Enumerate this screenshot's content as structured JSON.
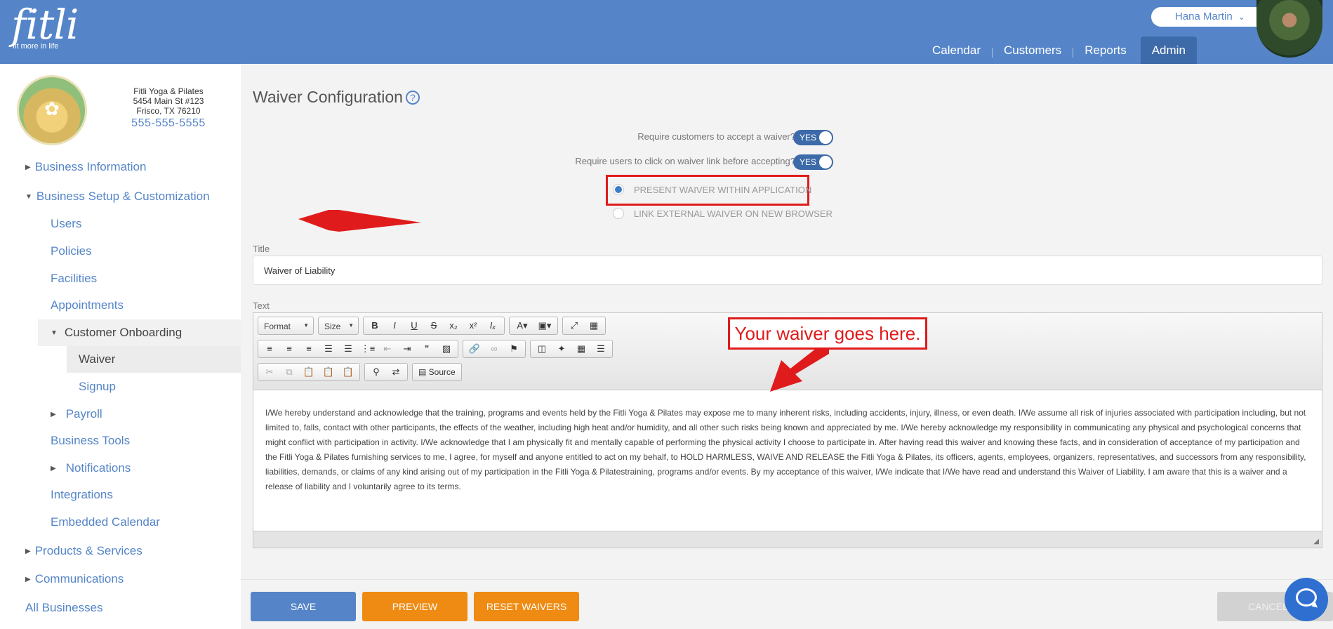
{
  "header": {
    "logo_text": "fitli",
    "logo_tagline": "fit more in life",
    "user_name": "Hana Martin",
    "nav": [
      "Calendar",
      "Customers",
      "Reports",
      "Admin"
    ],
    "active_nav": "Admin"
  },
  "business": {
    "name": "Fitli Yoga & Pilates",
    "address1": "5454 Main St #123",
    "address2": "Frisco, TX 76210",
    "phone": "555-555-5555"
  },
  "sidebar": {
    "business_information": "Business Information",
    "business_setup": "Business Setup & Customization",
    "users": "Users",
    "policies": "Policies",
    "facilities": "Facilities",
    "appointments": "Appointments",
    "customer_onboarding": "Customer Onboarding",
    "waiver": "Waiver",
    "signup": "Signup",
    "payroll": "Payroll",
    "business_tools": "Business Tools",
    "notifications": "Notifications",
    "integrations": "Integrations",
    "embedded_calendar": "Embedded Calendar",
    "products_services": "Products & Services",
    "communications": "Communications",
    "all_businesses": "All Businesses"
  },
  "page": {
    "title": "Waiver Configuration",
    "help_glyph": "?"
  },
  "options": {
    "require_accept_label": "Require customers to accept a waiver?",
    "require_accept_value": "YES",
    "require_click_label": "Require users to click on waiver link before accepting?",
    "require_click_value": "YES",
    "radio_present": "PRESENT WAIVER WITHIN APPLICATION",
    "radio_link": "LINK EXTERNAL WAIVER ON NEW BROWSER",
    "selected_radio": "present"
  },
  "title_field": {
    "label": "Title",
    "value": "Waiver of Liability"
  },
  "text_field": {
    "label": "Text",
    "body": "I/We hereby understand and acknowledge that the training, programs and events held by the Fitli Yoga & Pilates may expose me to many inherent risks, including accidents, injury, illness, or even death. I/We assume all risk of injuries associated with participation including, but not limited to, falls, contact with other participants, the effects of the weather, including high heat and/or humidity, and all other such risks being known and appreciated by me. I/We hereby acknowledge my responsibility in communicating any physical and psychological concerns that might conflict with participation in activity. I/We acknowledge that I am physically fit and mentally capable of performing the physical activity I choose to participate in. After having read this waiver and knowing these facts, and in consideration of acceptance of my participation and the Fitli Yoga & Pilates furnishing services to me, I agree, for myself and anyone entitled to act on my behalf, to HOLD HARMLESS, WAIVE AND RELEASE the Fitli Yoga & Pilates, its officers, agents, employees, organizers, representatives, and successors from any responsibility, liabilities, demands, or claims of any kind arising out of my participation in the Fitli Yoga & Pilatestraining, programs and/or events. By my acceptance of this waiver, I/We indicate that I/We have read and understand this Waiver of Liability. I am aware that this is a waiver and a release of liability and I voluntarily agree to its terms."
  },
  "toolbar": {
    "format": "Format",
    "size": "Size",
    "source": "Source"
  },
  "annotation": {
    "callout": "Your waiver goes here."
  },
  "buttons": {
    "save": "SAVE",
    "preview": "PREVIEW",
    "reset": "RESET WAIVERS",
    "cancel": "CANCEL"
  },
  "colors": {
    "brand_blue": "#5585c8",
    "orange": "#ef8b12",
    "annotation_red": "#e01b1b"
  }
}
